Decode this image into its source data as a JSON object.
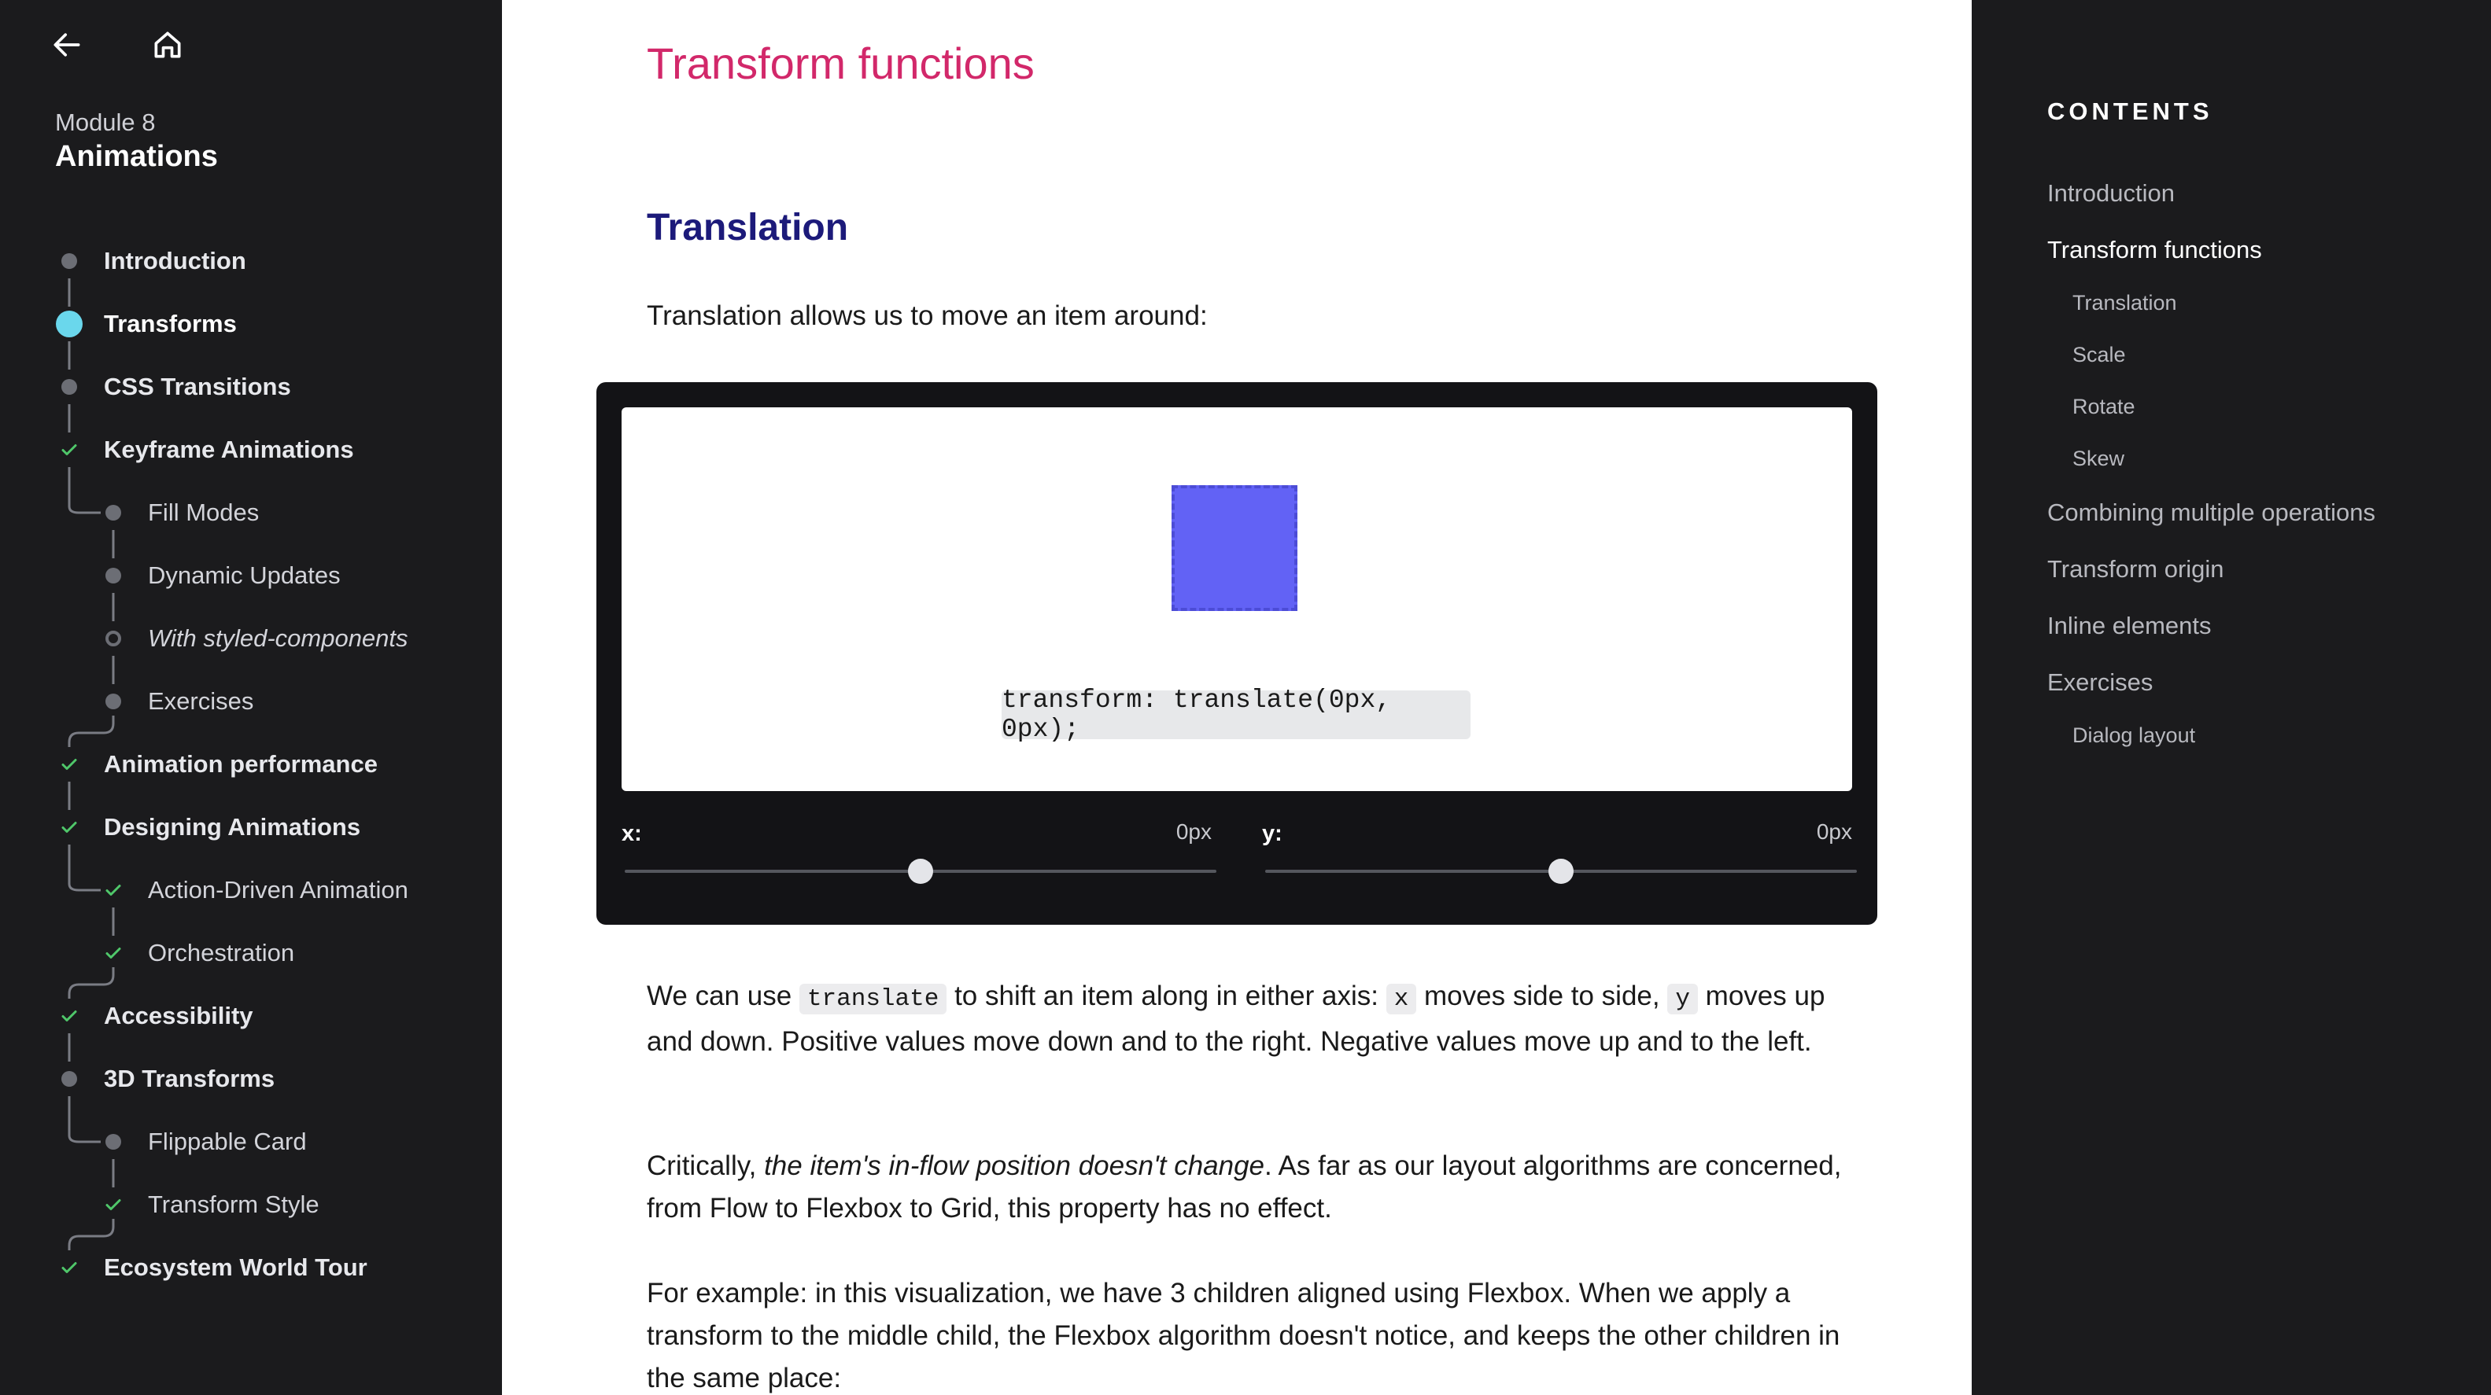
{
  "sidebar": {
    "back_icon": "arrow-left-icon",
    "home_icon": "home-icon",
    "module_label": "Module 8",
    "module_name": "Animations",
    "items": [
      {
        "label": "Introduction",
        "level": 1,
        "state": "dot"
      },
      {
        "label": "Transforms",
        "level": 1,
        "state": "active"
      },
      {
        "label": "CSS Transitions",
        "level": 1,
        "state": "dot"
      },
      {
        "label": "Keyframe Animations",
        "level": 1,
        "state": "check"
      },
      {
        "label": "Fill Modes",
        "level": 2,
        "state": "dot"
      },
      {
        "label": "Dynamic Updates",
        "level": 2,
        "state": "dot"
      },
      {
        "label": "With styled-components",
        "level": 2,
        "state": "ring"
      },
      {
        "label": "Exercises",
        "level": 2,
        "state": "dot"
      },
      {
        "label": "Animation performance",
        "level": 1,
        "state": "check"
      },
      {
        "label": "Designing Animations",
        "level": 1,
        "state": "check"
      },
      {
        "label": "Action-Driven Animation",
        "level": 2,
        "state": "check"
      },
      {
        "label": "Orchestration",
        "level": 2,
        "state": "check"
      },
      {
        "label": "Accessibility",
        "level": 1,
        "state": "check"
      },
      {
        "label": "3D Transforms",
        "level": 1,
        "state": "dot"
      },
      {
        "label": "Flippable Card",
        "level": 2,
        "state": "dot"
      },
      {
        "label": "Transform Style",
        "level": 2,
        "state": "check"
      },
      {
        "label": "Ecosystem World Tour",
        "level": 1,
        "state": "check"
      }
    ]
  },
  "main": {
    "page_title": "Transform functions",
    "section_title": "Translation",
    "intro": "Translation allows us to move an item around:",
    "demo": {
      "code": "transform: translate(0px, 0px);",
      "x_label": "x:",
      "x_value": "0px",
      "x_position": 0.5,
      "y_label": "y:",
      "y_value": "0px",
      "y_position": 0.5
    },
    "p1": {
      "t1": "We can use ",
      "c1": "translate",
      "t2": " to shift an item along in either axis: ",
      "c2": "x",
      "t3": " moves side to side, ",
      "c3": "y",
      "t4": " moves up and down. Positive values move down and to the right. Negative values move up and to the left."
    },
    "p2": {
      "t1": "Critically, ",
      "em": "the item's in-flow position doesn't change",
      "t2": ". As far as our layout algorithms are concerned, from Flow to Flexbox to Grid, this property has no effect."
    },
    "p3": "For example: in this visualization, we have 3 children aligned using Flexbox. When we apply a transform to the middle child, the Flexbox algorithm doesn't notice, and keeps the other children in the same place:"
  },
  "toc": {
    "heading": "CONTENTS",
    "items": [
      {
        "label": "Introduction",
        "level": 1,
        "active": false
      },
      {
        "label": "Transform functions",
        "level": 1,
        "active": true
      },
      {
        "label": "Translation",
        "level": 2,
        "active": false
      },
      {
        "label": "Scale",
        "level": 2,
        "active": false
      },
      {
        "label": "Rotate",
        "level": 2,
        "active": false
      },
      {
        "label": "Skew",
        "level": 2,
        "active": false
      },
      {
        "label": "Combining multiple operations",
        "level": 1,
        "active": false
      },
      {
        "label": "Transform origin",
        "level": 1,
        "active": false
      },
      {
        "label": "Inline elements",
        "level": 1,
        "active": false
      },
      {
        "label": "Exercises",
        "level": 1,
        "active": false
      },
      {
        "label": "Dialog layout",
        "level": 2,
        "active": false
      }
    ]
  },
  "colors": {
    "sidebar_bg": "#1b1b1d",
    "active_dot": "#6ad7ec",
    "check": "#4fc76a",
    "page_title": "#d2286a",
    "section_title": "#1c1a7a",
    "box": "#6262f5"
  }
}
